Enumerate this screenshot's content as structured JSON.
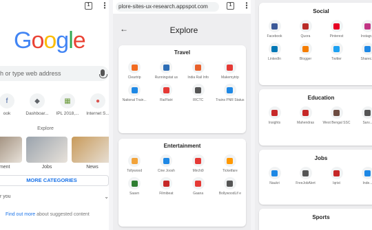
{
  "left_panel": {
    "tab_count": "1",
    "logo": {
      "letters": [
        "G",
        "o",
        "o",
        "g",
        "l",
        "e"
      ],
      "colors": [
        "#4285F4",
        "#EA4335",
        "#FBBC05",
        "#4285F4",
        "#34A853",
        "#EA4335"
      ]
    },
    "search_placeholder": "h or type web address",
    "shortcuts": [
      {
        "label": "ook",
        "icon": "f",
        "color": "#3b5998"
      },
      {
        "label": "Dashboar...",
        "icon": "◆",
        "color": "#5f6368"
      },
      {
        "label": "IPL 2018,...",
        "icon": "▦",
        "color": "#6a9a3a"
      },
      {
        "label": "Internet S...",
        "icon": "●",
        "color": "#d9534f"
      }
    ],
    "explore_label": "Explore",
    "tiles": [
      {
        "label": "ainment",
        "color": "#8a7560"
      },
      {
        "label": "Jobs",
        "color": "#9aa3ad"
      },
      {
        "label": "News",
        "color": "#c89a5a"
      }
    ],
    "more_categories": "MORE CATEGORIES",
    "for_you": "r you",
    "find_more_link": "Find out more",
    "find_more_text": " about suggested content"
  },
  "middle_panel": {
    "url": "plore-sites-ux-research.appspot.com",
    "tab_count": "1",
    "title": "Explore",
    "sections": [
      {
        "title": "Travel",
        "apps": [
          {
            "label": "Cleartrip",
            "color": "#f26b21"
          },
          {
            "label": "Runningstat us",
            "color": "#2d6db5"
          },
          {
            "label": "India Rail Info",
            "color": "#e8612c"
          },
          {
            "label": "Makemytrip",
            "color": "#e53935"
          },
          {
            "label": "National Train...",
            "color": "#1e88e5"
          },
          {
            "label": "RailYatri",
            "color": "#e53935"
          },
          {
            "label": "IRCTC",
            "color": "#555555"
          },
          {
            "label": "Trains PNR Status",
            "color": "#1e88e5"
          }
        ]
      },
      {
        "title": "Entertainment",
        "apps": [
          {
            "label": "Tollywood",
            "color": "#f2a33a"
          },
          {
            "label": "Cine Joosh",
            "color": "#1e88e5"
          },
          {
            "label": "Mirchi9",
            "color": "#e53935"
          },
          {
            "label": "Ticketfare",
            "color": "#ff9800"
          },
          {
            "label": "Saavn",
            "color": "#2e7d32"
          },
          {
            "label": "Filmibeat",
            "color": "#c62828"
          },
          {
            "label": "Gaana",
            "color": "#e53935"
          },
          {
            "label": "BollywoodLif e",
            "color": "#555555"
          }
        ]
      }
    ]
  },
  "right_panel": {
    "sections": [
      {
        "title": "Social",
        "apps": [
          {
            "label": "Facebook",
            "color": "#3b5998"
          },
          {
            "label": "Quora",
            "color": "#b92b27"
          },
          {
            "label": "Pinterest",
            "color": "#e60023"
          },
          {
            "label": "Instagr...",
            "color": "#c13584"
          },
          {
            "label": "LinkedIn",
            "color": "#0077b5"
          },
          {
            "label": "Blogger",
            "color": "#f57d00"
          },
          {
            "label": "Twitter",
            "color": "#1da1f2"
          },
          {
            "label": "Sharec...",
            "color": "#1e88e5"
          }
        ]
      },
      {
        "title": "Education",
        "apps": [
          {
            "label": "Insights",
            "color": "#c62828"
          },
          {
            "label": "Mahendras",
            "color": "#c62828"
          },
          {
            "label": "West Bengal SSC",
            "color": "#6d4c41"
          },
          {
            "label": "Sarv...",
            "color": "#555555"
          }
        ]
      },
      {
        "title": "Jobs",
        "apps": [
          {
            "label": "Naukri",
            "color": "#1e88e5"
          },
          {
            "label": "FreeJobAlert",
            "color": "#555555"
          },
          {
            "label": "Iqrist",
            "color": "#c62828"
          },
          {
            "label": "Inde...",
            "color": "#1e88e5"
          }
        ]
      },
      {
        "title": "Sports",
        "apps": []
      }
    ]
  }
}
